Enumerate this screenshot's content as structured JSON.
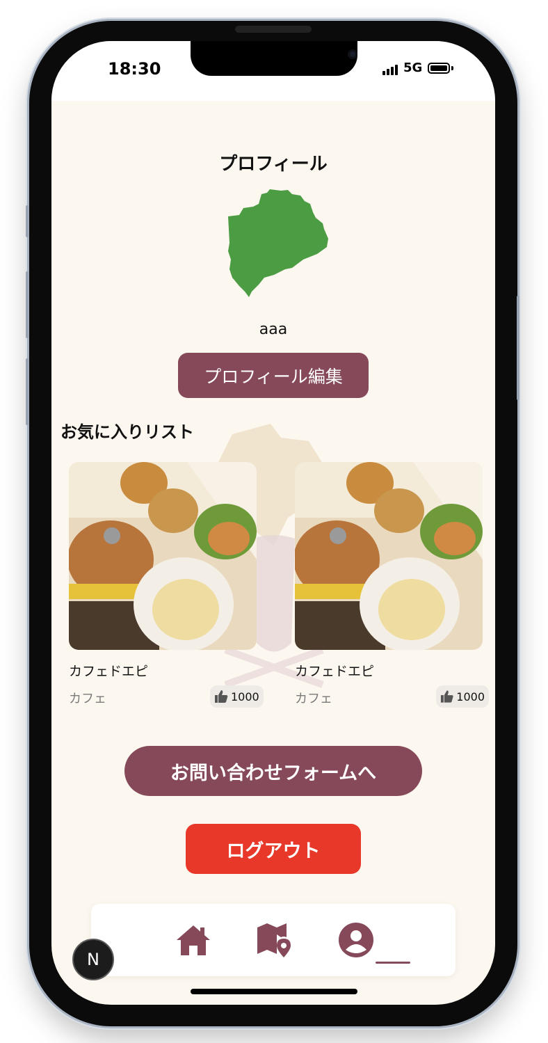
{
  "status_bar": {
    "time": "18:30",
    "network": "5G"
  },
  "page_title": "プロフィール",
  "profile": {
    "username": "aaa",
    "edit_button": "プロフィール編集"
  },
  "favorites": {
    "title": "お気に入りリスト",
    "items": [
      {
        "name": "カフェドエピ",
        "category": "カフェ",
        "likes": "1000"
      },
      {
        "name": "カフェドエピ",
        "category": "カフェ",
        "likes": "1000"
      }
    ]
  },
  "contact_button": "お問い合わせフォームへ",
  "logout_button": "ログアウト",
  "nav": {
    "items": [
      {
        "icon": "home-icon"
      },
      {
        "icon": "map-pin-icon"
      },
      {
        "icon": "user-profile-icon",
        "active": true
      }
    ]
  },
  "dev_badge": "N",
  "colors": {
    "primary": "#864959",
    "danger": "#e7382a",
    "background": "#fcf7ef",
    "map_green": "#4c9c44"
  }
}
